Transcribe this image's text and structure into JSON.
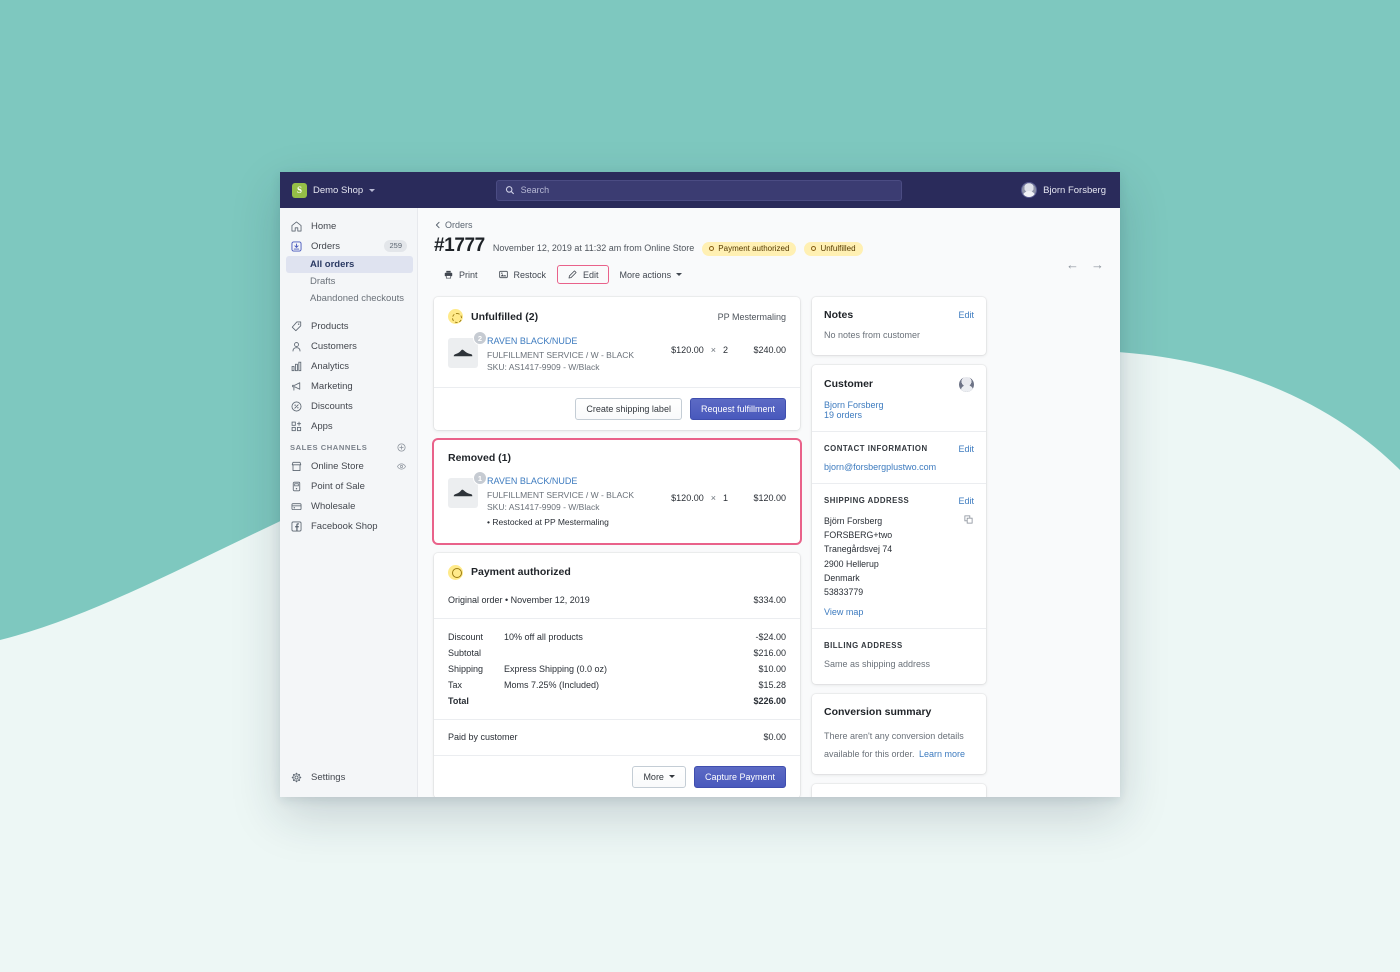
{
  "background": {
    "teal": "#7ec8bf",
    "mint": "#edf7f5"
  },
  "topbar": {
    "shop_name": "Demo Shop",
    "shop_caret_icon": "chevron-down-icon",
    "search_icon": "search-icon",
    "search_placeholder": "Search",
    "search_value": "",
    "user_name": "Bjorn Forsberg",
    "avatar_icon": "user-avatar"
  },
  "sidebar": {
    "items": [
      {
        "label": "Home",
        "icon": "home-icon",
        "badge": ""
      },
      {
        "label": "Orders",
        "icon": "orders-icon",
        "badge": "259"
      },
      {
        "label": "Products",
        "icon": "tag-icon",
        "badge": ""
      },
      {
        "label": "Customers",
        "icon": "person-icon",
        "badge": ""
      },
      {
        "label": "Analytics",
        "icon": "bar-chart-icon",
        "badge": ""
      },
      {
        "label": "Marketing",
        "icon": "megaphone-icon",
        "badge": ""
      },
      {
        "label": "Discounts",
        "icon": "discount-icon",
        "badge": ""
      },
      {
        "label": "Apps",
        "icon": "apps-icon",
        "badge": ""
      }
    ],
    "orders_sub": [
      {
        "label": "All orders",
        "active": true
      },
      {
        "label": "Drafts",
        "active": false
      },
      {
        "label": "Abandoned checkouts",
        "active": false
      }
    ],
    "sales_channels_label": "SALES CHANNELS",
    "add_channel_icon": "plus-circle-icon",
    "channels": [
      {
        "label": "Online Store",
        "icon": "store-icon",
        "trailing_icon": "eye-icon"
      },
      {
        "label": "Point of Sale",
        "icon": "pos-icon",
        "trailing_icon": ""
      },
      {
        "label": "Wholesale",
        "icon": "wholesale-icon",
        "trailing_icon": ""
      },
      {
        "label": "Facebook Shop",
        "icon": "facebook-icon",
        "trailing_icon": ""
      }
    ],
    "settings": {
      "label": "Settings",
      "icon": "gear-icon"
    }
  },
  "order": {
    "breadcrumb": "Orders",
    "breadcrumb_icon": "chevron-left-icon",
    "number": "#1777",
    "meta": "November 12, 2019 at 11:32 am from Online Store",
    "badges": [
      {
        "label": "Payment authorized"
      },
      {
        "label": "Unfulfilled"
      }
    ],
    "actions": [
      {
        "label": "Print",
        "icon": "printer-icon",
        "highlighted": false
      },
      {
        "label": "Restock",
        "icon": "restock-icon",
        "highlighted": false
      },
      {
        "label": "Edit",
        "icon": "pencil-icon",
        "highlighted": true
      },
      {
        "label": "More actions",
        "icon": "",
        "highlighted": false
      }
    ],
    "prev_icon": "arrow-left-icon",
    "next_icon": "arrow-right-icon"
  },
  "unfulfilled_card": {
    "title": "Unfulfilled (2)",
    "status_icon": "pending-circle-icon",
    "location": "PP Mestermaling",
    "item": {
      "qty_badge": "2",
      "thumb_icon": "shoe-thumbnail",
      "title": "RAVEN BLACK/NUDE",
      "variant": "FULFILLMENT SERVICE / W - BLACK",
      "sku": "SKU: AS1417-9909 - W/Black",
      "price": "$120.00",
      "times": "×",
      "qty": "2",
      "total": "$240.00"
    },
    "buttons": [
      {
        "label": "Create shipping label",
        "primary": false
      },
      {
        "label": "Request fulfillment",
        "primary": true
      }
    ]
  },
  "removed_card": {
    "title": "Removed (1)",
    "item": {
      "qty_badge": "1",
      "thumb_icon": "shoe-thumbnail",
      "title": "RAVEN BLACK/NUDE",
      "variant": "FULFILLMENT SERVICE / W - BLACK",
      "sku": "SKU: AS1417-9909 - W/Black",
      "note": "• Restocked at PP Mestermaling",
      "price": "$120.00",
      "times": "×",
      "qty": "1",
      "total": "$120.00"
    }
  },
  "payment_card": {
    "title": "Payment authorized",
    "status_icon": "clock-circle-icon",
    "original_order_label": "Original order • November 12, 2019",
    "original_order_amount": "$334.00",
    "rows": [
      {
        "label": "Discount",
        "desc": "10% off all products",
        "amount": "-$24.00",
        "bold": false
      },
      {
        "label": "Subtotal",
        "desc": "",
        "amount": "$216.00",
        "bold": false
      },
      {
        "label": "Shipping",
        "desc": "Express Shipping (0.0 oz)",
        "amount": "$10.00",
        "bold": false
      },
      {
        "label": "Tax",
        "desc": "Moms 7.25% (Included)",
        "amount": "$15.28",
        "bold": false
      },
      {
        "label": "Total",
        "desc": "",
        "amount": "$226.00",
        "bold": true
      }
    ],
    "paid_label": "Paid by customer",
    "paid_amount": "$0.00",
    "buttons": [
      {
        "label": "More",
        "primary": false,
        "caret": true
      },
      {
        "label": "Capture Payment",
        "primary": true,
        "caret": false
      }
    ]
  },
  "notes_card": {
    "title": "Notes",
    "edit_label": "Edit",
    "body": "No notes from customer"
  },
  "customer_card": {
    "title": "Customer",
    "avatar_icon": "user-avatar",
    "name": "Bjorn Forsberg",
    "orders_count": "19 orders",
    "contact_section_title": "CONTACT INFORMATION",
    "contact_edit_label": "Edit",
    "email": "bjorn@forsbergplustwo.com",
    "shipping_section_title": "SHIPPING ADDRESS",
    "shipping_edit_label": "Edit",
    "copy_icon": "copy-icon",
    "address_lines": [
      "Björn Forsberg",
      "FORSBERG+two",
      "Tranegårdsvej 74",
      "2900 Hellerup",
      "Denmark",
      "53833779"
    ],
    "view_map_label": "View map",
    "billing_section_title": "BILLING ADDRESS",
    "billing_text": "Same as shipping address"
  },
  "conversion_card": {
    "title": "Conversion summary",
    "body": "There aren't any conversion details available for this order.",
    "link": "Learn more"
  }
}
